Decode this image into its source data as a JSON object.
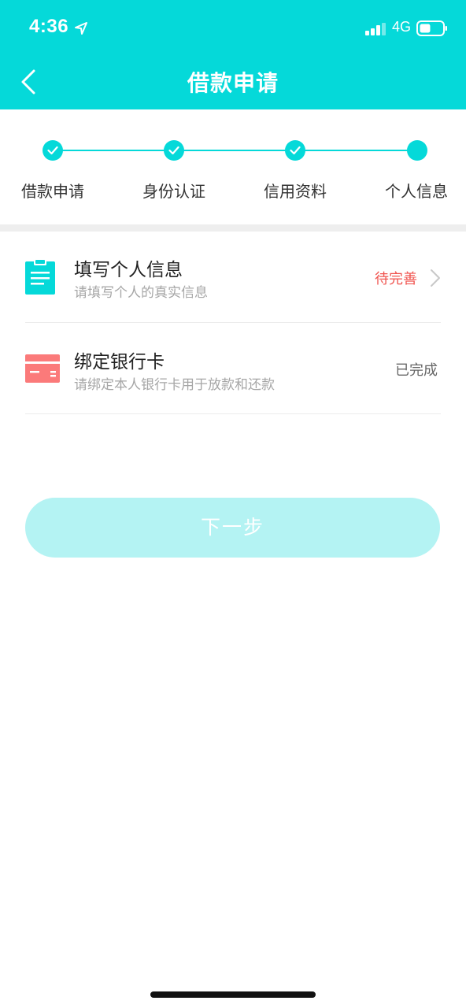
{
  "status_bar": {
    "time": "4:36",
    "network": "4G",
    "location_icon": "location-arrow-icon",
    "signal_icon": "signal-bars-icon",
    "battery_icon": "battery-icon"
  },
  "nav": {
    "title": "借款申请",
    "back_icon": "chevron-left-icon"
  },
  "steps": [
    {
      "label": "借款申请",
      "state": "done"
    },
    {
      "label": "身份认证",
      "state": "done"
    },
    {
      "label": "信用资料",
      "state": "done"
    },
    {
      "label": "个人信息",
      "state": "current"
    }
  ],
  "items": [
    {
      "title": "填写个人信息",
      "subtitle": "请填写个人的真实信息",
      "status": "待完善",
      "status_color": "#f0544f",
      "icon": "clipboard-icon",
      "has_arrow": true
    },
    {
      "title": "绑定银行卡",
      "subtitle": "请绑定本人银行卡用于放款和还款",
      "status": "已完成",
      "status_color": "#666666",
      "icon": "bank-card-icon",
      "has_arrow": false
    }
  ],
  "next_button": {
    "label": "下一步"
  },
  "colors": {
    "brand": "#05d9d9",
    "button_disabled": "#b4f3f3",
    "pending": "#f0544f",
    "card_icon": "#fb7a7a"
  }
}
